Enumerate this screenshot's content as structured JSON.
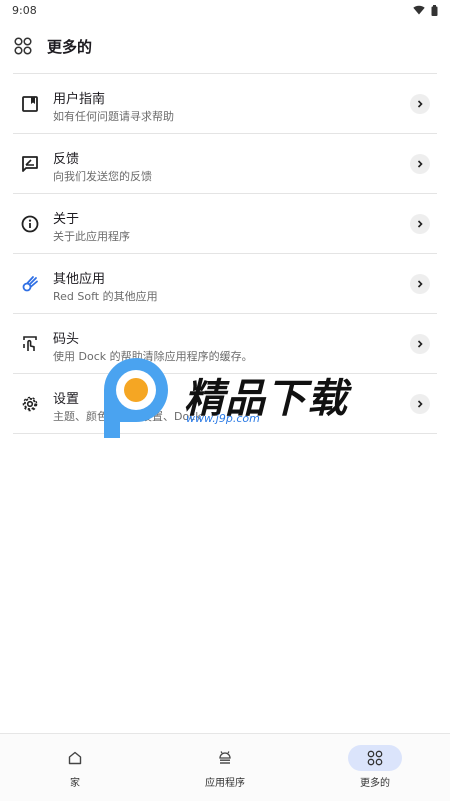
{
  "status_bar": {
    "time": "9:08",
    "icons": [
      "wifi-icon",
      "battery-icon"
    ]
  },
  "app_bar": {
    "icon": "grid-icon",
    "title": "更多的"
  },
  "menu": [
    {
      "icon": "book-icon",
      "title": "用户指南",
      "subtitle": "如有任何问题请寻求帮助"
    },
    {
      "icon": "feedback-icon",
      "title": "反馈",
      "subtitle": "向我们发送您的反馈"
    },
    {
      "icon": "info-icon",
      "title": "关于",
      "subtitle": "关于此应用程序"
    },
    {
      "icon": "comet-icon",
      "title": "其他应用",
      "subtitle": "Red Soft 的其他应用",
      "icon_color": "#2f6fe4"
    },
    {
      "icon": "dock-touch-icon",
      "title": "码头",
      "subtitle": "使用 Dock 的帮助清除应用程序的缓存。"
    },
    {
      "icon": "settings-gear-icon",
      "title": "设置",
      "subtitle": "主题、颜色、涂鸦设置、Dock"
    }
  ],
  "watermark": {
    "text": "精品下载",
    "url": "www.j9p.com"
  },
  "bottom_nav": [
    {
      "icon": "home-icon",
      "label": "家",
      "active": false
    },
    {
      "icon": "android-icon",
      "label": "应用程序",
      "active": false
    },
    {
      "icon": "grid-icon",
      "label": "更多的",
      "active": true
    }
  ],
  "colors": {
    "accent_pill": "#dbe4fb",
    "comet_icon": "#2f6fe4",
    "watermark_blue": "#2c7be5",
    "watermark_orange": "#f5a623"
  }
}
